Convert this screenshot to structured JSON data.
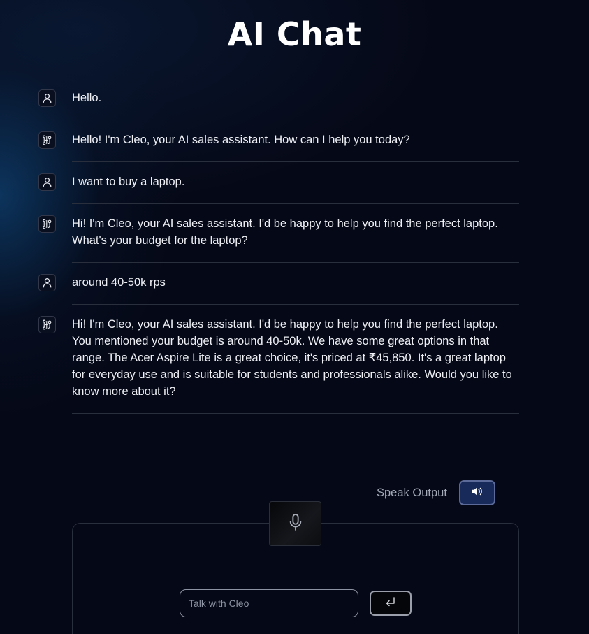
{
  "app": {
    "title": "AI Chat"
  },
  "messages": [
    {
      "role": "user",
      "icon": "user-icon",
      "text": "Hello."
    },
    {
      "role": "assistant",
      "icon": "bot-icon",
      "text": "Hello! I'm Cleo, your AI sales assistant. How can I help you today?"
    },
    {
      "role": "user",
      "icon": "user-icon",
      "text": "I want to buy a laptop."
    },
    {
      "role": "assistant",
      "icon": "bot-icon",
      "text": "Hi! I'm Cleo, your AI sales assistant. I'd be happy to help you find the perfect laptop. What's your budget for the laptop?"
    },
    {
      "role": "user",
      "icon": "user-icon",
      "text": "around 40-50k rps"
    },
    {
      "role": "assistant",
      "icon": "bot-icon",
      "text": "Hi! I'm Cleo, your AI sales assistant. I'd be happy to help you find the perfect laptop. You mentioned your budget is around 40-50k. We have some great options in that range. The Acer Aspire Lite is a great choice, it's priced at ₹45,850. It's a great laptop for everyday use and is suitable for students and professionals alike. Would you like to know more about it?"
    }
  ],
  "controls": {
    "speak_output_label": "Speak Output",
    "speak_icon": "speaker-icon",
    "mic_icon": "microphone-icon",
    "input_placeholder": "Talk with Cleo",
    "input_value": "",
    "send_icon": "enter-icon"
  },
  "colors": {
    "background": "#050816",
    "accent_button": "#182a5a",
    "divider": "#2a2f3d"
  }
}
